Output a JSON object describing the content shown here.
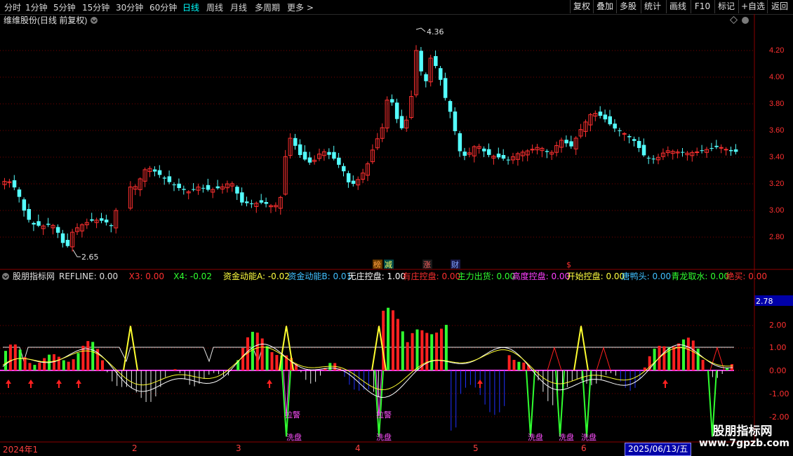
{
  "toolbar": {
    "periods": [
      "分时",
      "1分钟",
      "5分钟",
      "15分钟",
      "30分钟",
      "60分钟",
      "日线",
      "周线",
      "月线",
      "多周期",
      "更多 >"
    ],
    "active_period": "日线",
    "right_buttons": [
      "复权",
      "叠加",
      "多股",
      "统计",
      "画线",
      "F10",
      "标记",
      "+自选",
      "返回"
    ]
  },
  "main_chart": {
    "title": "维维股份(日线 前复权)",
    "price_ticks": [
      "4.20",
      "4.00",
      "3.80",
      "3.60",
      "3.40",
      "3.20",
      "3.00",
      "2.80"
    ],
    "max_label": "4.36",
    "min_label": "2.65",
    "tags": [
      "榜",
      "减",
      "涨",
      "财",
      "$"
    ]
  },
  "indicator": {
    "name": "股朋指标网",
    "items": [
      {
        "label": "REFLINE: 0.00",
        "color": "#e0e0e0"
      },
      {
        "label": "X3: 0.00",
        "color": "#ff3030"
      },
      {
        "label": "X4: -0.02",
        "color": "#30ff30"
      },
      {
        "label": "资金动能A: -0.02",
        "color": "#ffff40"
      },
      {
        "label": "资金动能B: 0.01",
        "color": "#40c0ff"
      },
      {
        "label": "无庄控盘: 1.00",
        "color": "#ffffff"
      },
      {
        "label": "有庄控盘: 0.00",
        "color": "#ff3030"
      },
      {
        "label": "主力出货: 0.00",
        "color": "#30ff30"
      },
      {
        "label": "高度控盘: 0.00",
        "color": "#ff40ff"
      },
      {
        "label": "开始控盘: 0.00",
        "color": "#ffff40"
      },
      {
        "label": "唐鸭头: 0.00",
        "color": "#40c0ff"
      },
      {
        "label": "青龙取水: 0.00",
        "color": "#30ff30"
      },
      {
        "label": "绝买: 0.00",
        "color": "#ff3030"
      }
    ],
    "y_ticks": [
      "2.00",
      "1.00",
      "0.00",
      "-1.00",
      "-2.00"
    ],
    "current_value": "2.78",
    "annotations": [
      "拉警",
      "拉警",
      "洗盘",
      "洗盘",
      "洗盘",
      "洗盘",
      "洗盘"
    ]
  },
  "time_axis": {
    "labels": [
      "2024年1",
      "2",
      "3",
      "4",
      "5",
      "6"
    ],
    "current_date": "2025/06/13/五"
  },
  "watermark": {
    "title": "股朋指标网",
    "url": "www.7gpzb.com"
  },
  "colors": {
    "up": "#ff3030",
    "down": "#54ffff",
    "grid": "#7a0000",
    "axis": "#8a0000"
  }
}
